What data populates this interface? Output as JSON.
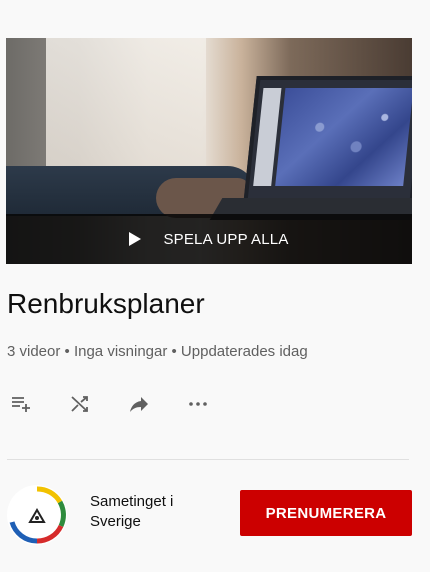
{
  "playlist": {
    "play_all_label": "SPELA UPP ALLA",
    "title": "Renbruksplaner",
    "meta": "3 videor • Inga visningar • Uppdaterades idag"
  },
  "actions": [
    {
      "icon": "add-to-queue-icon"
    },
    {
      "icon": "shuffle-icon"
    },
    {
      "icon": "share-icon"
    },
    {
      "icon": "more-icon"
    }
  ],
  "channel": {
    "name": "Sametinget i Sverige",
    "subscribe_label": "PRENUMERERA"
  },
  "colors": {
    "subscribe_bg": "#cc0000",
    "text_primary": "#0f0f0f",
    "text_secondary": "#606060"
  }
}
